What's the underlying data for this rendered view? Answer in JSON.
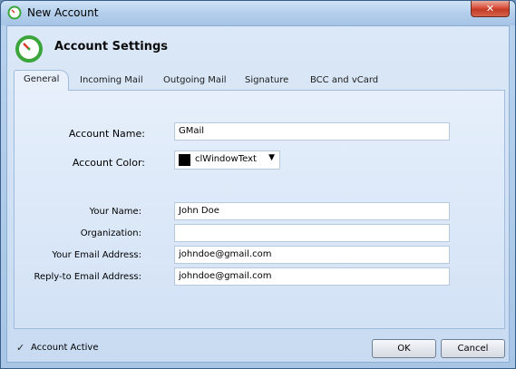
{
  "window": {
    "title": "New Account",
    "close_symbol": "✕"
  },
  "header": {
    "title": "Account Settings"
  },
  "tabs": [
    {
      "label": "General",
      "active": true
    },
    {
      "label": "Incoming Mail",
      "active": false
    },
    {
      "label": "Outgoing Mail",
      "active": false
    },
    {
      "label": "Signature",
      "active": false
    },
    {
      "label": "BCC and vCard",
      "active": false
    }
  ],
  "general": {
    "account_name_label": "Account Name:",
    "account_name_value": "GMail",
    "account_color_label": "Account Color:",
    "account_color_value": "clWindowText",
    "account_color_swatch": "#000000",
    "your_name_label": "Your Name:",
    "your_name_value": "John Doe",
    "organization_label": "Organization:",
    "organization_value": "",
    "email_label": "Your Email Address:",
    "email_value": "johndoe@gmail.com",
    "reply_to_label": "Reply-to Email Address:",
    "reply_to_value": "johndoe@gmail.com"
  },
  "footer": {
    "account_active_label": "Account Active",
    "account_active_checked": true,
    "check_mark": "✓",
    "ok_label": "OK",
    "cancel_label": "Cancel"
  }
}
